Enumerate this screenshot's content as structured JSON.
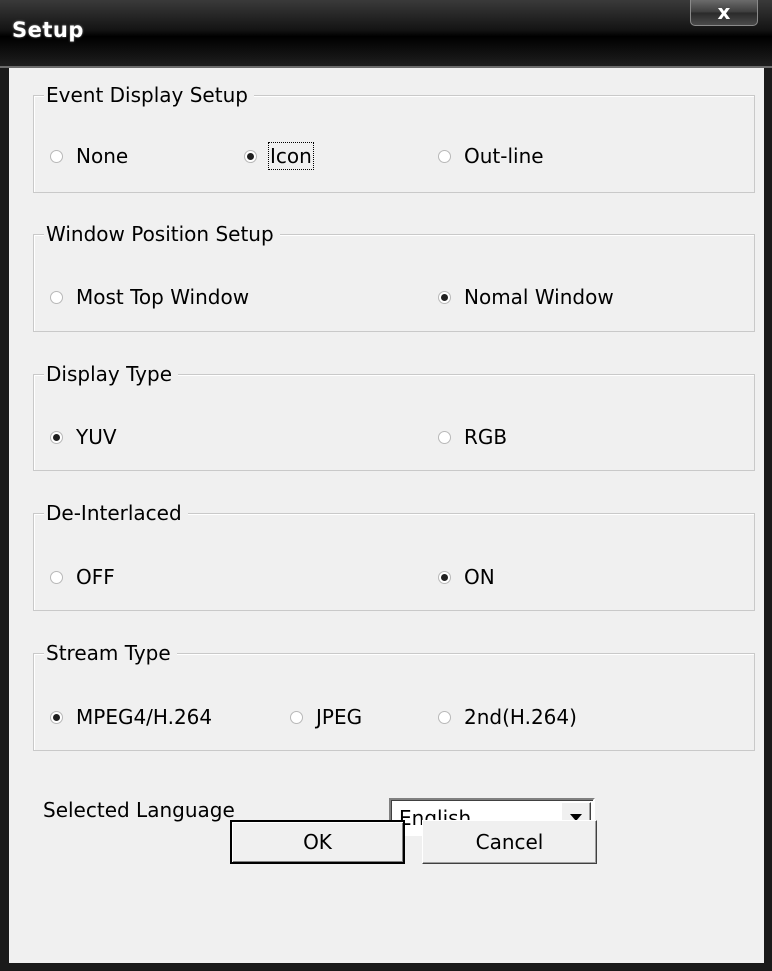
{
  "window": {
    "title": "Setup",
    "close_glyph": "x",
    "close_icon": "close-icon"
  },
  "groups": {
    "event_display": {
      "label": "Event Display Setup",
      "options": [
        {
          "label": "None",
          "checked": false
        },
        {
          "label": "Icon",
          "checked": true,
          "focused": true
        },
        {
          "label": "Out-line",
          "checked": false
        }
      ]
    },
    "window_position": {
      "label": "Window Position Setup",
      "options": [
        {
          "label": "Most Top Window",
          "checked": false
        },
        {
          "label": "Nomal Window",
          "checked": true
        }
      ]
    },
    "display_type": {
      "label": "Display Type",
      "options": [
        {
          "label": "YUV",
          "checked": true
        },
        {
          "label": "RGB",
          "checked": false
        }
      ]
    },
    "de_interlaced": {
      "label": "De-Interlaced",
      "options": [
        {
          "label": "OFF",
          "checked": false
        },
        {
          "label": "ON",
          "checked": true
        }
      ]
    },
    "stream_type": {
      "label": "Stream Type",
      "options": [
        {
          "label": "MPEG4/H.264",
          "checked": true
        },
        {
          "label": "JPEG",
          "checked": false
        },
        {
          "label": "2nd(H.264)",
          "checked": false
        }
      ]
    }
  },
  "language": {
    "label": "Selected Language",
    "selected": "English",
    "dropdown_icon": "chevron-down-icon"
  },
  "buttons": {
    "ok": "OK",
    "cancel": "Cancel"
  }
}
